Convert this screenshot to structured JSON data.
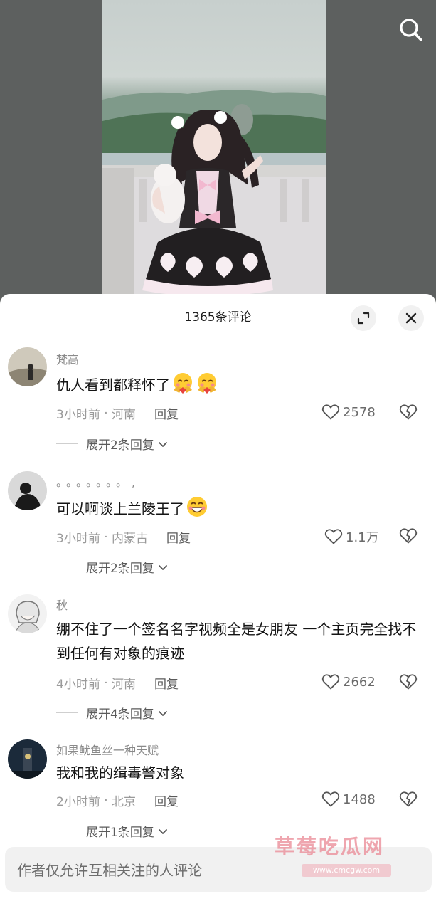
{
  "sheet": {
    "title": "1365条评论"
  },
  "comments": [
    {
      "username": "梵高",
      "text": "仇人看到都释怀了",
      "emojis": [
        "hug-emoji",
        "hug-emoji"
      ],
      "time": "3小时前",
      "location": "河南",
      "reply_label": "回复",
      "likes": "2578",
      "expand_label": "展开2条回复"
    },
    {
      "username": "。。。。。。。,",
      "text": "可以啊谈上兰陵王了",
      "emojis": [
        "grin-emoji"
      ],
      "time": "3小时前",
      "location": "内蒙古",
      "reply_label": "回复",
      "likes": "1.1万",
      "expand_label": "展开2条回复"
    },
    {
      "username": "秋",
      "text": "绷不住了一个签名名字视频全是女朋友 一个主页完全找不到任何有对象的痕迹",
      "emojis": [],
      "time": "4小时前",
      "location": "河南",
      "reply_label": "回复",
      "likes": "2662",
      "expand_label": "展开4条回复"
    },
    {
      "username": "如果鱿鱼丝一种天赋",
      "text": "我和我的缉毒警对象",
      "emojis": [],
      "time": "2小时前",
      "location": "北京",
      "reply_label": "回复",
      "likes": "1488",
      "expand_label": "展开1条回复"
    }
  ],
  "input": {
    "placeholder": "作者仅允许互相关注的人评论"
  },
  "watermark": {
    "title": "草莓吃瓜网",
    "url": "www.cmcgw.com"
  },
  "icons": {
    "search": "search-icon",
    "expand": "fullscreen-icon",
    "close": "close-icon",
    "like": "heart-icon",
    "dislike": "broken-heart-icon",
    "chevron": "chevron-down-icon"
  },
  "colors": {
    "sheet_background": "#ffffff",
    "text_primary": "#141414",
    "text_secondary": "#9a9a9a",
    "watermark": "#e98894"
  }
}
